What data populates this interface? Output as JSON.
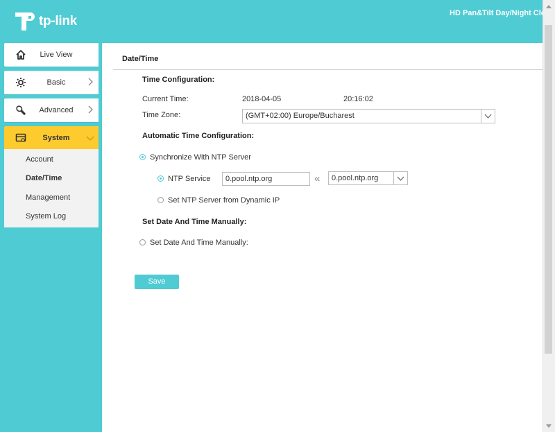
{
  "header": {
    "logo_text": "tp-link",
    "product_name": "HD Pan&Tilt Day/Night Clou"
  },
  "sidebar": {
    "items": [
      {
        "label": "Live View",
        "icon": "home-icon"
      },
      {
        "label": "Basic",
        "icon": "gear-icon"
      },
      {
        "label": "Advanced",
        "icon": "wrench-icon"
      },
      {
        "label": "System",
        "icon": "system-icon"
      }
    ],
    "submenu": [
      "Account",
      "Date/Time",
      "Management",
      "System Log"
    ],
    "active_item": "System",
    "active_submenu": "Date/Time"
  },
  "page": {
    "title": "Date/Time",
    "time_config": {
      "heading": "Time Configuration:",
      "current_time_label": "Current Time:",
      "current_date": "2018-04-05",
      "current_time": "20:16:02",
      "time_zone_label": "Time Zone:",
      "time_zone_value": "(GMT+02:00) Europe/Bucharest"
    },
    "auto_config": {
      "heading": "Automatic Time Configuration:",
      "sync_ntp_label": "Synchronize With NTP Server",
      "ntp_service_label": "NTP Service",
      "ntp_service_value": "0.pool.ntp.org",
      "ntp_select_value": "0.pool.ntp.org",
      "dynamic_ip_label": "Set NTP Server from Dynamic IP"
    },
    "manual_config": {
      "heading": "Set Date And Time Manually:",
      "manual_label": "Set Date And Time Manually:"
    },
    "save_label": "Save"
  },
  "colors": {
    "accent": "#4ecbd3",
    "active_nav": "#fecb2f",
    "submenu_bg": "#f2f2f2"
  }
}
